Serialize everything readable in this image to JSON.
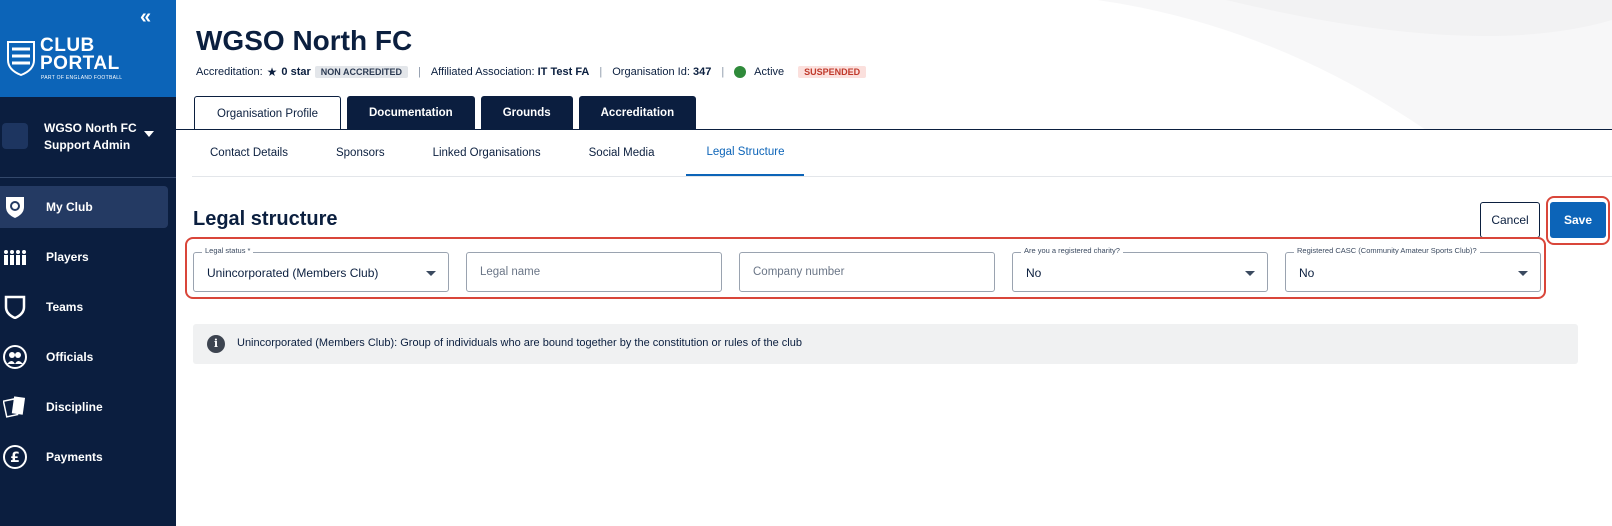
{
  "sidebar": {
    "collapse_glyph": "«",
    "logo_line1": "CLUB",
    "logo_line2": "PORTAL",
    "logo_sub": "PART OF ENGLAND FOOTBALL",
    "user_name": "WGSO North FC",
    "user_role": "Support Admin",
    "items": [
      {
        "label": "My Club",
        "icon": "club-crest-icon",
        "active": true
      },
      {
        "label": "Players",
        "icon": "players-icon"
      },
      {
        "label": "Teams",
        "icon": "shield-icon"
      },
      {
        "label": "Officials",
        "icon": "officials-icon"
      },
      {
        "label": "Discipline",
        "icon": "cards-icon"
      },
      {
        "label": "Payments",
        "icon": "pound-icon"
      }
    ]
  },
  "header": {
    "org_name": "WGSO North FC",
    "accreditation_label": "Accreditation:",
    "accreditation_value": "0 star",
    "accreditation_badge": "NON ACCREDITED",
    "affiliated_label": "Affiliated Association:",
    "affiliated_value": "IT Test FA",
    "org_id_label": "Organisation Id:",
    "org_id_value": "347",
    "status_label": "Active",
    "status_badge": "SUSPENDED"
  },
  "tabs": [
    {
      "label": "Organisation Profile",
      "active": true
    },
    {
      "label": "Documentation"
    },
    {
      "label": "Grounds"
    },
    {
      "label": "Accreditation"
    }
  ],
  "subtabs": [
    {
      "label": "Contact Details"
    },
    {
      "label": "Sponsors"
    },
    {
      "label": "Linked Organisations"
    },
    {
      "label": "Social Media"
    },
    {
      "label": "Legal Structure",
      "active": true
    }
  ],
  "section": {
    "title": "Legal structure",
    "cancel_label": "Cancel",
    "save_label": "Save"
  },
  "fields": {
    "legal_status_label": "Legal status *",
    "legal_status_value": "Unincorporated (Members Club)",
    "legal_name_placeholder": "Legal name",
    "company_number_placeholder": "Company number",
    "charity_label": "Are you a registered charity?",
    "charity_value": "No",
    "casc_label": "Registered CASC (Community Amateur Sports Club)?",
    "casc_value": "No"
  },
  "info": {
    "icon_glyph": "i",
    "text": "Unincorporated (Members Club): Group of individuals who are bound together by the constitution or rules of the club"
  },
  "colors": {
    "sidebar_bg": "#0b1e3f",
    "logo_bg": "#0c64b8",
    "accent": "#0c64b8",
    "highlight_ring": "#d9463a",
    "status_active": "#2f8a3a",
    "suspended_text": "#c0392b"
  }
}
